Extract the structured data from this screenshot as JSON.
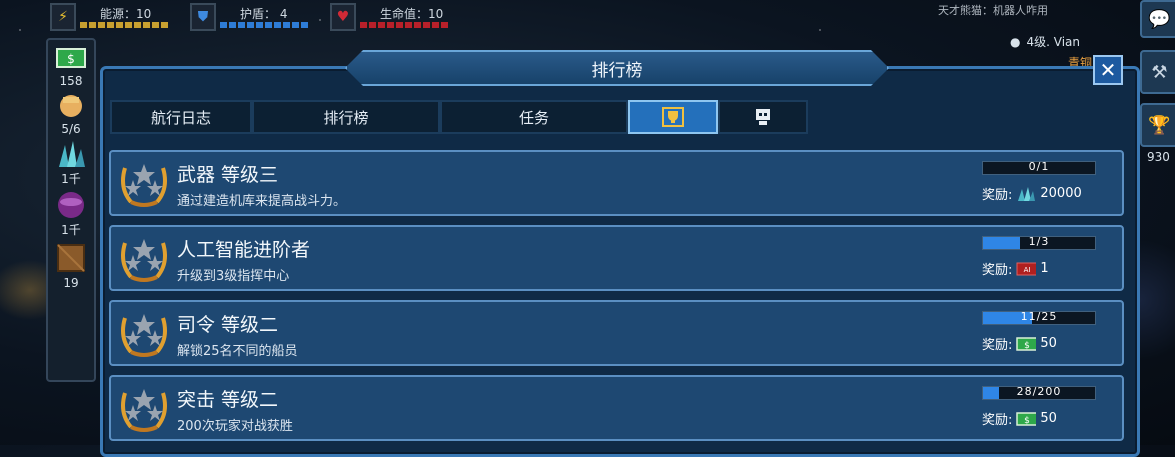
{
  "topbar": {
    "energy": {
      "label": "能源：10",
      "icon": "lightning-icon"
    },
    "shield": {
      "label": "护盾： 4",
      "icon": "shield-icon"
    },
    "health": {
      "label": "生命值：10",
      "icon": "heart-icon"
    }
  },
  "sidebar": {
    "items": [
      {
        "icon": "money-icon",
        "value": "158"
      },
      {
        "icon": "crew-icon",
        "value": "5/6"
      },
      {
        "icon": "crystal-icon",
        "value": "1千"
      },
      {
        "icon": "planet-icon",
        "value": "1千"
      },
      {
        "icon": "crate-icon",
        "value": "19"
      }
    ]
  },
  "right": {
    "chat_preview": "天才熊猫：机器人咋用",
    "level_text": "4级. Vian",
    "partial_text": "青铜",
    "side_value": "930"
  },
  "panel": {
    "title": "排行榜",
    "close_label": "✕",
    "tabs": [
      {
        "label": "航行日志"
      },
      {
        "label": "排行榜"
      },
      {
        "label": "任务"
      },
      {
        "label": "",
        "icon": "trophy-icon"
      },
      {
        "label": "",
        "icon": "robot-icon"
      }
    ],
    "reward_label": "奖励:",
    "rows": [
      {
        "title": "武器 等级三",
        "desc": "通过建造机库来提高战斗力。",
        "progress": "0/1",
        "fraction": 0,
        "reward_icon": "crystal-icon",
        "reward": "20000"
      },
      {
        "title": "人工智能进阶者",
        "desc": "升级到3级指挥中心",
        "progress": "1/3",
        "fraction": 0.333,
        "reward_icon": "ai-chip-icon",
        "reward": "1"
      },
      {
        "title": "司令 等级二",
        "desc": "解锁25名不同的船员",
        "progress": "11/25",
        "fraction": 0.44,
        "reward_icon": "money-icon",
        "reward": "50"
      },
      {
        "title": "突击 等级二",
        "desc": "200次玩家对战获胜",
        "progress": "28/200",
        "fraction": 0.14,
        "reward_icon": "money-icon",
        "reward": "50"
      }
    ]
  },
  "colors": {
    "accent": "#2f86e6",
    "panel": "#0f2a46",
    "row": "#1e4872",
    "gold": "#e0a030"
  }
}
